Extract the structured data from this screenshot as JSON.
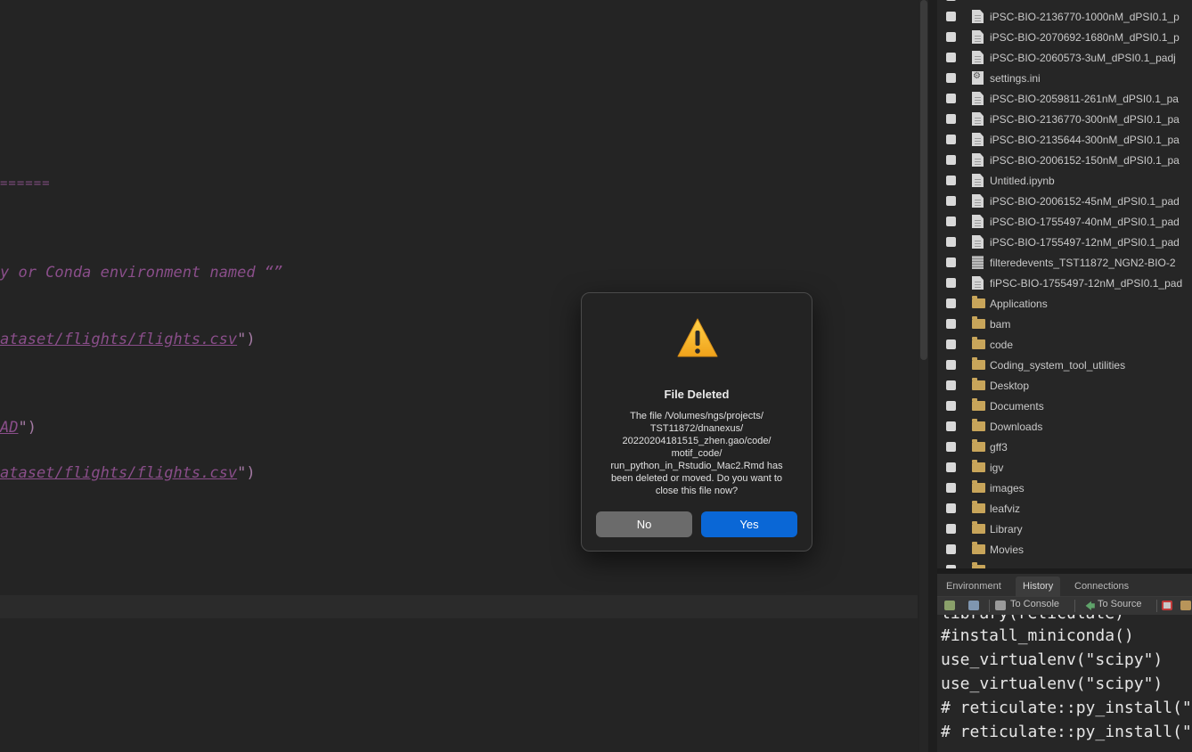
{
  "editor": {
    "lines": [
      {
        "text": "======",
        "kind": "faint"
      },
      {
        "text": "y or Conda environment named “”"
      },
      {
        "link": "ataset/flights/flights.csv",
        "tail": "\")"
      },
      {
        "link": "AD",
        "tail": "\")"
      },
      {
        "link": "ataset/flights/flights.csv",
        "tail": "\")"
      }
    ]
  },
  "files": {
    "items": [
      {
        "name": "iPSC-BIO-2136770-1000nM_dPSI0.1_p",
        "icon": "doc-icon"
      },
      {
        "name": "iPSC-BIO-2070692-1680nM_dPSI0.1_p",
        "icon": "doc-icon"
      },
      {
        "name": "iPSC-BIO-2060573-3uM_dPSI0.1_padj",
        "icon": "doc-icon"
      },
      {
        "name": "settings.ini",
        "icon": "gear-doc-icon"
      },
      {
        "name": "iPSC-BIO-2059811-261nM_dPSI0.1_pa",
        "icon": "doc-icon"
      },
      {
        "name": "iPSC-BIO-2136770-300nM_dPSI0.1_pa",
        "icon": "doc-icon"
      },
      {
        "name": "iPSC-BIO-2135644-300nM_dPSI0.1_pa",
        "icon": "doc-icon"
      },
      {
        "name": "iPSC-BIO-2006152-150nM_dPSI0.1_pa",
        "icon": "doc-icon"
      },
      {
        "name": "Untitled.ipynb",
        "icon": "doc-icon"
      },
      {
        "name": "iPSC-BIO-2006152-45nM_dPSI0.1_pad",
        "icon": "doc-icon"
      },
      {
        "name": "iPSC-BIO-1755497-40nM_dPSI0.1_pad",
        "icon": "doc-icon"
      },
      {
        "name": "iPSC-BIO-1755497-12nM_dPSI0.1_pad",
        "icon": "doc-icon"
      },
      {
        "name": "filteredevents_TST11872_NGN2-BIO-2",
        "icon": "grid-icon"
      },
      {
        "name": "fiPSC-BIO-1755497-12nM_dPSI0.1_pad",
        "icon": "doc-icon"
      },
      {
        "name": "Applications",
        "icon": "folder-icon"
      },
      {
        "name": "bam",
        "icon": "folder-icon"
      },
      {
        "name": "code",
        "icon": "folder-icon"
      },
      {
        "name": "Coding_system_tool_utilities",
        "icon": "folder-icon"
      },
      {
        "name": "Desktop",
        "icon": "folder-icon"
      },
      {
        "name": "Documents",
        "icon": "folder-icon"
      },
      {
        "name": "Downloads",
        "icon": "folder-icon"
      },
      {
        "name": "gff3",
        "icon": "folder-icon"
      },
      {
        "name": "igv",
        "icon": "folder-icon"
      },
      {
        "name": "images",
        "icon": "folder-icon"
      },
      {
        "name": "leafviz",
        "icon": "folder-icon"
      },
      {
        "name": "Library",
        "icon": "folder-icon"
      },
      {
        "name": "Movies",
        "icon": "folder-icon"
      }
    ]
  },
  "history_pane": {
    "tabs": [
      "Environment",
      "History",
      "Connections"
    ],
    "active_tab": "History",
    "toolbar": {
      "to_console": "To Console",
      "to_source": "To Source"
    },
    "lines": [
      "library(reticulate)",
      "#install_miniconda()",
      "use_virtualenv(\"scipy\")",
      "use_virtualenv(\"scipy\")",
      "# reticulate::py_install(\"pa",
      "# reticulate::py_install(\"in"
    ]
  },
  "dialog": {
    "title": "File Deleted",
    "message": "The file /Volumes/ngs/projects/ TST11872/dnanexus/ 20220204181515_zhen.gao/code/ motif_code/ run_python_in_Rstudio_Mac2.Rmd has been deleted or moved. Do you want to close this file now?",
    "no_label": "No",
    "yes_label": "Yes",
    "icon": "warning-icon"
  },
  "colors": {
    "dialog_yes": "#0a67d6",
    "dialog_no": "#6b6b6b",
    "editor_bg": "#242424",
    "code_purple": "#8a4e8a",
    "folder": "#c8a55a"
  }
}
